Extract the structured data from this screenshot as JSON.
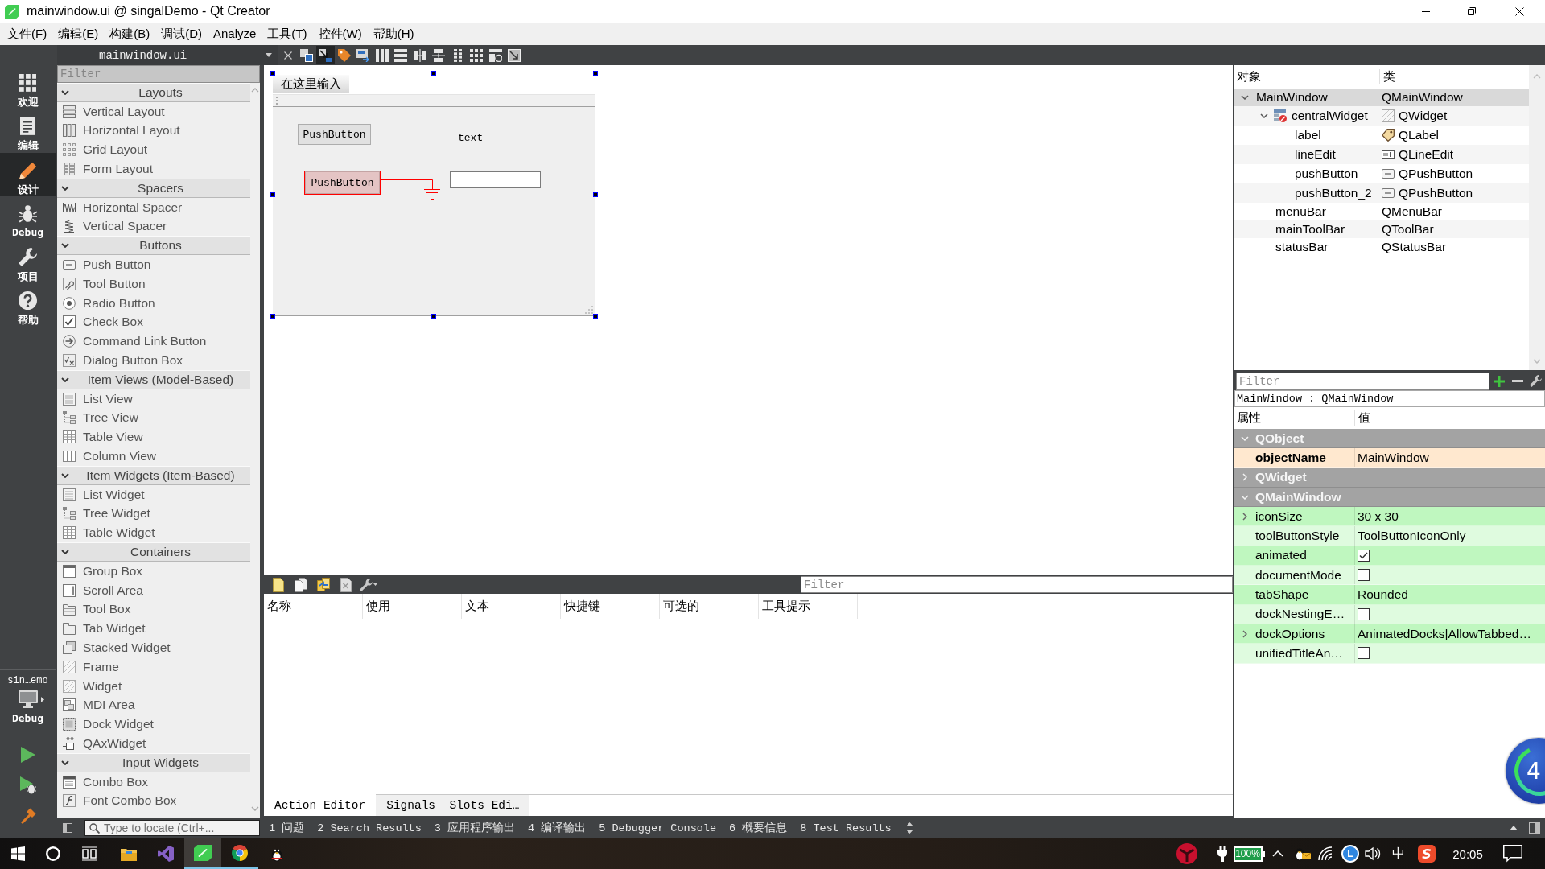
{
  "window": {
    "title": "mainwindow.ui @ singalDemo - Qt Creator"
  },
  "menu_bar": {
    "items": [
      "文件(F)",
      "编辑(E)",
      "构建(B)",
      "调试(D)",
      "Analyze",
      "工具(T)",
      "控件(W)",
      "帮助(H)"
    ]
  },
  "mode_bar": {
    "modes": [
      {
        "label": "欢迎",
        "selected": false
      },
      {
        "label": "编辑",
        "selected": false
      },
      {
        "label": "设计",
        "selected": true
      },
      {
        "label": "Debug",
        "selected": false
      },
      {
        "label": "项目",
        "selected": false
      },
      {
        "label": "帮助",
        "selected": false
      }
    ],
    "project": "sin…emo",
    "build_config": "Debug"
  },
  "designer_toolbar": {
    "document": "mainwindow.ui",
    "tools": [
      {
        "selected": false
      },
      {
        "selected": true
      },
      {
        "selected": false
      },
      {
        "selected": false
      },
      {
        "selected": false
      },
      {
        "selected": false
      },
      {
        "selected": false
      },
      {
        "selected": false
      },
      {
        "selected": false
      },
      {
        "selected": false
      },
      {
        "selected": false
      },
      {
        "selected": false
      }
    ]
  },
  "widget_box": {
    "filter": {
      "placeholder": "Filter"
    },
    "groups": [
      {
        "title": "Layouts",
        "expanded": true,
        "items": [
          "Vertical Layout",
          "Horizontal Layout",
          "Grid Layout",
          "Form Layout"
        ]
      },
      {
        "title": "Spacers",
        "expanded": true,
        "items": [
          "Horizontal Spacer",
          "Vertical Spacer"
        ]
      },
      {
        "title": "Buttons",
        "expanded": true,
        "items": [
          "Push Button",
          "Tool Button",
          "Radio Button",
          "Check Box",
          "Command Link Button",
          "Dialog Button Box"
        ]
      },
      {
        "title": "Item Views (Model-Based)",
        "expanded": true,
        "items": [
          "List View",
          "Tree View",
          "Table View",
          "Column View"
        ]
      },
      {
        "title": "Item Widgets (Item-Based)",
        "expanded": true,
        "items": [
          "List Widget",
          "Tree Widget",
          "Table Widget"
        ]
      },
      {
        "title": "Containers",
        "expanded": true,
        "items": [
          "Group Box",
          "Scroll Area",
          "Tool Box",
          "Tab Widget",
          "Stacked Widget",
          "Frame",
          "Widget",
          "MDI Area",
          "Dock Widget",
          "QAxWidget"
        ]
      },
      {
        "title": "Input Widgets",
        "expanded": true,
        "items": [
          "Combo Box",
          "Font Combo Box"
        ]
      }
    ]
  },
  "form": {
    "menu_entry": "在这里输入",
    "selected": true,
    "widgets": [
      {
        "kind": "push_button",
        "text": "PushButton",
        "highlighted": false
      },
      {
        "kind": "label",
        "text": "text"
      },
      {
        "kind": "push_button",
        "text": "PushButton",
        "highlighted": true
      },
      {
        "kind": "line_edit"
      }
    ]
  },
  "action_editor": {
    "filter": {
      "placeholder": "Filter"
    },
    "columns": [
      "名称",
      "使用",
      "文本",
      "快捷键",
      "可选的",
      "工具提示"
    ],
    "tabs": [
      {
        "label": "Action Editor",
        "selected": true
      },
      {
        "label": "Signals  Slots Edi…",
        "selected": false
      }
    ]
  },
  "object_inspector": {
    "columns": [
      "对象",
      "类"
    ],
    "tree": [
      {
        "name": "MainWindow",
        "class": "QMainWindow",
        "selected": true,
        "expanded": true,
        "children": [
          {
            "name": "centralWidget",
            "class": "QWidget",
            "kind": "container",
            "selected": false,
            "expanded": true,
            "children": [
              {
                "name": "label",
                "class": "QLabel",
                "kind": "label",
                "selected": false
              },
              {
                "name": "lineEdit",
                "class": "QLineEdit",
                "kind": "line_edit",
                "selected": false
              },
              {
                "name": "pushButton",
                "class": "QPushButton",
                "kind": "push_button",
                "selected": false
              },
              {
                "name": "pushButton_2",
                "class": "QPushButton",
                "kind": "push_button",
                "selected": false
              }
            ]
          },
          {
            "name": "menuBar",
            "class": "QMenuBar",
            "kind": "bar",
            "selected": false
          },
          {
            "name": "mainToolBar",
            "class": "QToolBar",
            "kind": "bar",
            "selected": false
          },
          {
            "name": "statusBar",
            "class": "QStatusBar",
            "kind": "bar",
            "selected": false
          }
        ]
      }
    ]
  },
  "property_editor": {
    "filter": {
      "placeholder": "Filter"
    },
    "object": "MainWindow : QMainWindow",
    "columns": [
      "属性",
      "值"
    ],
    "sections": [
      {
        "title": "QObject",
        "expanded": true,
        "color": "#ffe8cf",
        "properties": [
          {
            "name": "objectName",
            "kind": "text",
            "value": "MainWindow",
            "modified": true,
            "expandable": false
          }
        ]
      },
      {
        "title": "QWidget",
        "expanded": false
      },
      {
        "title": "QMainWindow",
        "expanded": true,
        "color": "#bff7bf",
        "properties": [
          {
            "name": "iconSize",
            "kind": "text",
            "value": "30 x 30",
            "modified": false,
            "expandable": true
          },
          {
            "name": "toolButtonStyle",
            "kind": "text",
            "value": "ToolButtonIconOnly",
            "modified": false,
            "expandable": false
          },
          {
            "name": "animated",
            "kind": "checkbox",
            "checked": true,
            "modified": false,
            "expandable": false
          },
          {
            "name": "documentMode",
            "kind": "checkbox",
            "checked": false,
            "modified": false,
            "expandable": false
          },
          {
            "name": "tabShape",
            "kind": "text",
            "value": "Rounded",
            "modified": false,
            "expandable": false
          },
          {
            "name": "dockNestingE…",
            "kind": "checkbox",
            "checked": false,
            "modified": false,
            "expandable": false
          },
          {
            "name": "dockOptions",
            "kind": "text",
            "value": "AnimatedDocks|AllowTabbed…",
            "modified": false,
            "expandable": true
          },
          {
            "name": "unifiedTitleAn…",
            "kind": "checkbox",
            "checked": false,
            "modified": false,
            "expandable": false
          }
        ]
      }
    ]
  },
  "output_bar": {
    "locator": {
      "placeholder": "Type to locate (Ctrl+..."
    },
    "panes": [
      "1 问题",
      "2 Search Results",
      "3 应用程序输出",
      "4 编译输出",
      "5 Debugger Console",
      "6 概要信息",
      "8 Test Results"
    ]
  },
  "taskbar": {
    "apps": [
      {
        "selected": false,
        "running": false
      },
      {
        "selected": false,
        "running": false
      },
      {
        "selected": true,
        "running": true
      },
      {
        "selected": false,
        "running": true
      },
      {
        "selected": false,
        "running": false
      }
    ],
    "battery": "100%",
    "tray_badges": [
      {
        "kind": "circle",
        "text": "L"
      },
      {
        "kind": "tile",
        "text": "S"
      }
    ],
    "input_method": "中",
    "clock": "20:05"
  },
  "floating_ball": {
    "text": "4"
  }
}
